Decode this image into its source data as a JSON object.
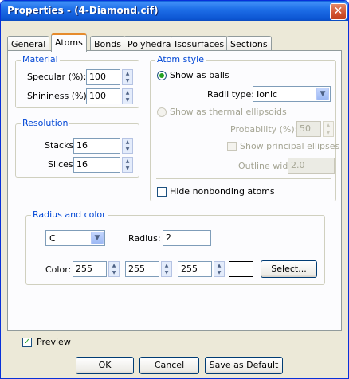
{
  "window": {
    "title": "Properties - (4-Diamond.cif)"
  },
  "tabs": [
    "General",
    "Atoms",
    "Bonds",
    "Polyhedra",
    "Isosurfaces",
    "Sections"
  ],
  "material": {
    "title": "Material",
    "specular_label": "Specular (%):",
    "specular_value": "100",
    "shininess_label": "Shininess (%):",
    "shininess_value": "100"
  },
  "resolution": {
    "title": "Resolution",
    "stacks_label": "Stacks:",
    "stacks_value": "16",
    "slices_label": "Slices:",
    "slices_value": "16"
  },
  "atom_style": {
    "title": "Atom style",
    "show_balls_label": "Show as balls",
    "radii_type_label": "Radii type:",
    "radii_type_value": "Ionic",
    "thermal_label": "Show as thermal ellipsoids",
    "probability_label": "Probability (%):",
    "probability_value": "50",
    "principal_label": "Show principal ellipses",
    "outline_label": "Outline width:",
    "outline_value": "2.0",
    "hide_nonbonding_label": "Hide nonbonding atoms"
  },
  "radius_color": {
    "title": "Radius and color",
    "element_value": "C",
    "radius_label": "Radius:",
    "radius_value": "2",
    "color_label": "Color:",
    "r": "255",
    "g": "255",
    "b": "255",
    "swatch_color": "#ffffff",
    "select_label": "Select..."
  },
  "footer": {
    "preview_label": "Preview",
    "ok_label": "OK",
    "cancel_label": "Cancel",
    "save_default_label": "Save as Default"
  },
  "icons": {
    "close": "close-icon",
    "spin": "spinner-arrows-icon",
    "dropdown": "chevron-down-icon",
    "check": "checkmark-icon"
  }
}
